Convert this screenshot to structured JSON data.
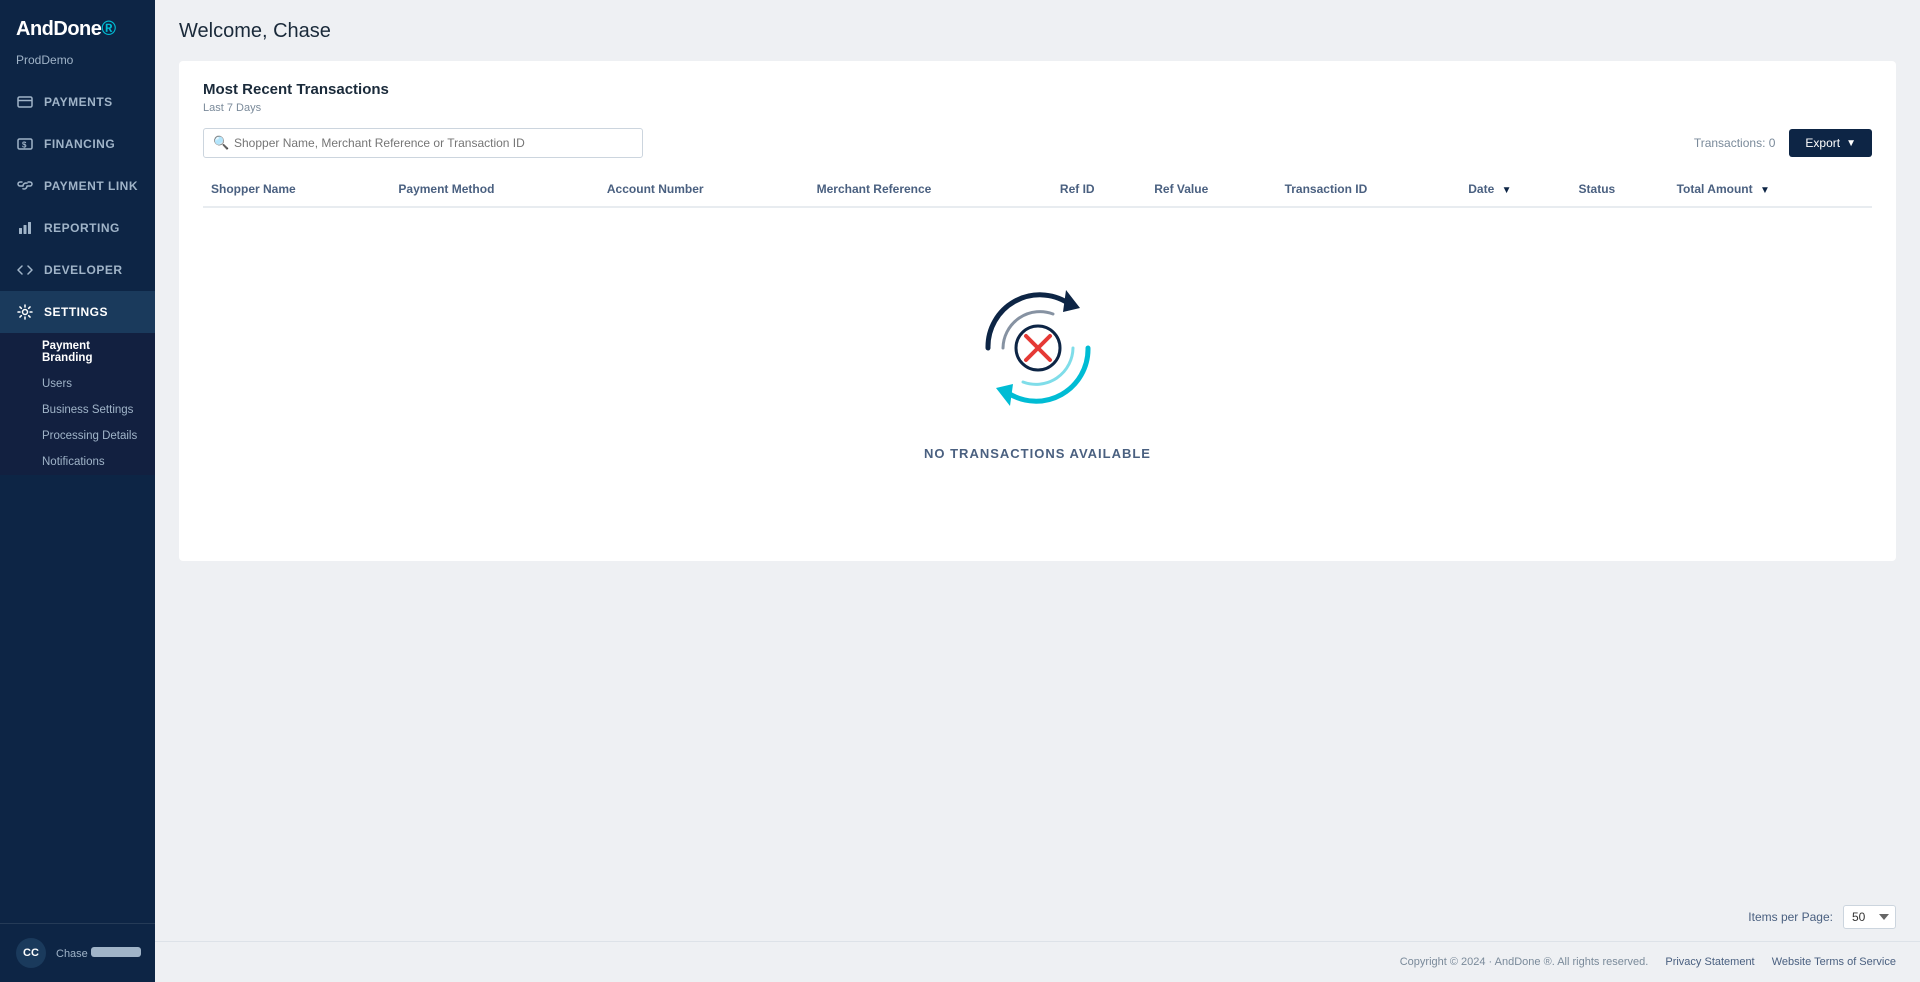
{
  "logo": {
    "brand": "AndDone",
    "dot": "."
  },
  "sidebar": {
    "account": "ProdDemo",
    "nav": [
      {
        "id": "payments",
        "label": "PAYMENTS",
        "icon": "credit-card",
        "active": false
      },
      {
        "id": "financing",
        "label": "FINANCING",
        "icon": "dollar",
        "active": false
      },
      {
        "id": "payment-link",
        "label": "PAYMENT LINK",
        "icon": "link",
        "active": false
      },
      {
        "id": "reporting",
        "label": "REPORTING",
        "icon": "bar-chart",
        "active": false
      },
      {
        "id": "developer",
        "label": "DEVELOPER",
        "icon": "code",
        "active": false
      },
      {
        "id": "settings",
        "label": "SETTINGS",
        "icon": "gear",
        "active": true
      }
    ],
    "settings_sub": [
      {
        "id": "payment-branding",
        "label": "Payment Branding",
        "active": true
      },
      {
        "id": "users",
        "label": "Users",
        "active": false
      },
      {
        "id": "business-settings",
        "label": "Business Settings",
        "active": false
      },
      {
        "id": "processing-details",
        "label": "Processing Details",
        "active": false
      },
      {
        "id": "notifications",
        "label": "Notifications",
        "active": false
      }
    ],
    "footer": {
      "initials": "CC",
      "name": "Chase"
    }
  },
  "page": {
    "title": "Welcome, Chase"
  },
  "transactions": {
    "card_title": "Most Recent Transactions",
    "date_range": "Last 7 Days",
    "search_placeholder": "Shopper Name, Merchant Reference or Transaction ID",
    "count_label": "Transactions: 0",
    "export_label": "Export",
    "columns": [
      "Shopper Name",
      "Payment Method",
      "Account Number",
      "Merchant Reference",
      "Ref ID",
      "Ref Value",
      "Transaction ID",
      "Date",
      "Status",
      "Total Amount"
    ],
    "empty_message": "NO TRANSACTIONS AVAILABLE"
  },
  "pagination": {
    "items_per_page_label": "Items per Page:",
    "items_per_page_value": "50"
  },
  "footer": {
    "copyright": "Copyright © 2024 · AndDone ®. All rights reserved.",
    "privacy": "Privacy Statement",
    "terms": "Website Terms of Service"
  }
}
